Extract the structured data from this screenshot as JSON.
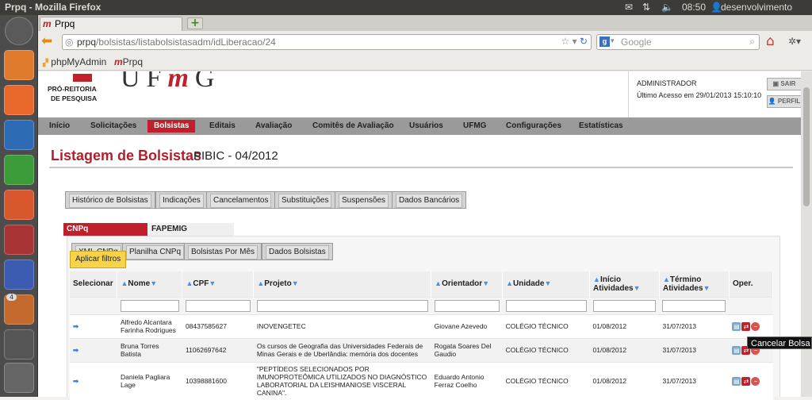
{
  "os": {
    "window_title": "Prpq - Mozilla Firefox",
    "time": "08:50",
    "user": "desenvolvimento",
    "workspace_count": "4"
  },
  "browser": {
    "tab_title": "Prpq",
    "url_host": "prpq",
    "url_path": "/bolsistas/listabolsistasadm/idLiberacao/24",
    "search_placeholder": "Google",
    "search_engine_icon": "google-icon",
    "bookmarks": [
      "phpMyAdmin",
      "Prpq"
    ]
  },
  "header": {
    "org_line1": "PRÓ-REITORIA",
    "org_line2": "DE PESQUISA",
    "logo_text_u": "UF",
    "logo_text_m": "m",
    "logo_text_g": "G",
    "user_name": "ADMINISTRADOR",
    "last_access": "Último Acesso em 29/01/2013 15:10:10",
    "logout_label": "SAIR",
    "profile_label": "PERFIL"
  },
  "menu": [
    "Início",
    "Solicitações",
    "Bolsistas",
    "Editais",
    "Avaliação",
    "Comitês de Avaliação",
    "Usuários",
    "UFMG",
    "Configurações",
    "Estatísticas"
  ],
  "menu_active": "Bolsistas",
  "page": {
    "title": "Listagem de Bolsistas",
    "subtitle": "PIBIC - 04/2012",
    "action_buttons": [
      "Histórico de Bolsistas",
      "Indicações",
      "Cancelamentos",
      "Substituições",
      "Suspensões",
      "Dados Bancários"
    ],
    "tabs": [
      "CNPq",
      "FAPEMIG"
    ],
    "active_tab": "CNPq",
    "sub_buttons": [
      "XML CNPq",
      "Planilha CNPq",
      "Bolsistas Por Mês",
      "Dados Bolsistas"
    ],
    "filter_button": "Aplicar filtros"
  },
  "table": {
    "columns": [
      "Selecionar",
      "Nome",
      "CPF",
      "Projeto",
      "Orientador",
      "Unidade",
      "Início Atividades",
      "Término Atividades",
      "Oper."
    ],
    "rows": [
      {
        "nome": "Alfredo Alcantara Farinha Rodrigues",
        "cpf": "08437585627",
        "projeto": "INOVENGETEC",
        "orientador": "Giovane Azevedo",
        "unidade": "COLÉGIO TÉCNICO",
        "inicio": "01/08/2012",
        "termino": "31/07/2013"
      },
      {
        "nome": "Bruna Torres Batista",
        "cpf": "11062697642",
        "projeto": "Os cursos de Geografia das Universidades Federais de Minas Gerais e de Uberlândia: memória dos docentes",
        "orientador": "Rogata Soares Del Gaudio",
        "unidade": "COLÉGIO TÉCNICO",
        "inicio": "01/08/2012",
        "termino": "31/07/2013"
      },
      {
        "nome": "Daniela Pagliara Lage",
        "cpf": "10398881600",
        "projeto": "\"PEPTÍDEOS SELECIONADOS POR IMUNOPROTEÔMICA UTILIZADOS NO DIAGNÓSTICO LABORATORIAL DA LEISHMANIOSE VISCERAL CANINA\".",
        "orientador": "Eduardo Antonio Ferraz Coelho",
        "unidade": "COLÉGIO TÉCNICO",
        "inicio": "01/08/2012",
        "termino": "31/07/2013"
      }
    ]
  },
  "tooltip": "Cancelar Bolsa"
}
